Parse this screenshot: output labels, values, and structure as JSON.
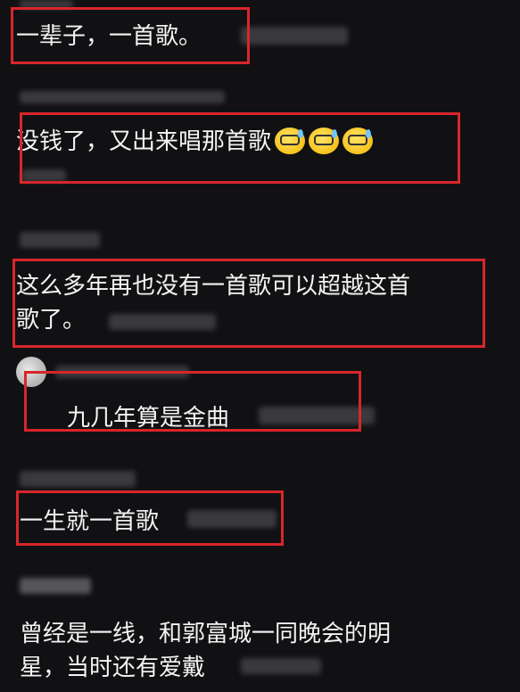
{
  "comments": [
    {
      "text": "一辈子，一首歌。"
    },
    {
      "text": "没钱了，又出来唱那首歌"
    },
    {
      "text_line1": "这么多年再也没有一首歌可以超越这首",
      "text_line2": "歌了。"
    },
    {
      "text": "九几年算是金曲"
    },
    {
      "text": "一生就一首歌"
    },
    {
      "text_line1": "曾经是一线，和郭富城一同晚会的明",
      "text_line2": "星，当时还有爱戴"
    }
  ],
  "emojis": [
    "sweat-glasses-emoji",
    "sweat-glasses-emoji",
    "sweat-glasses-emoji"
  ],
  "colors": {
    "background": "#111113",
    "highlight": "#d8262b",
    "text": "#f4f4f4"
  }
}
